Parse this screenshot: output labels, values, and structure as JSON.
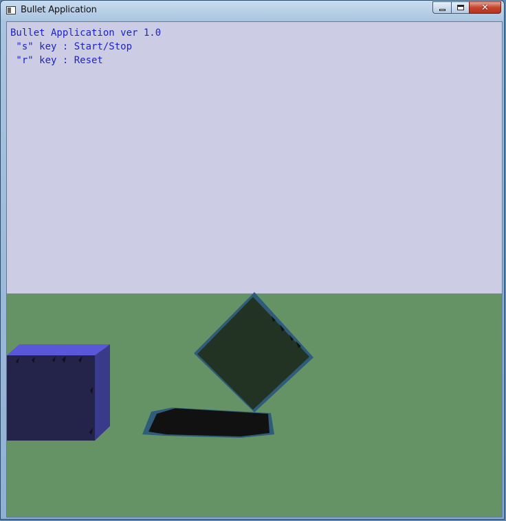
{
  "window": {
    "title": "Bullet Application",
    "buttons": {
      "minimize": "minimize-icon",
      "maximize": "maximize-icon",
      "close": "close-icon"
    }
  },
  "hud": {
    "line1": "Bullet Application ver 1.0",
    "line2": " \"s\" key : Start/Stop",
    "line3": " \"r\" key : Reset"
  },
  "scene": {
    "sky_color": "#cccce4",
    "ground_color": "#669366",
    "left_box_color": "#24244a",
    "left_box_top_color": "#5858d8",
    "left_box_side_color": "#3a3a8a",
    "tilted_box_color": "#233323",
    "tilted_box_edge_color": "#2e5c7a",
    "shadow_color": "#111111"
  }
}
